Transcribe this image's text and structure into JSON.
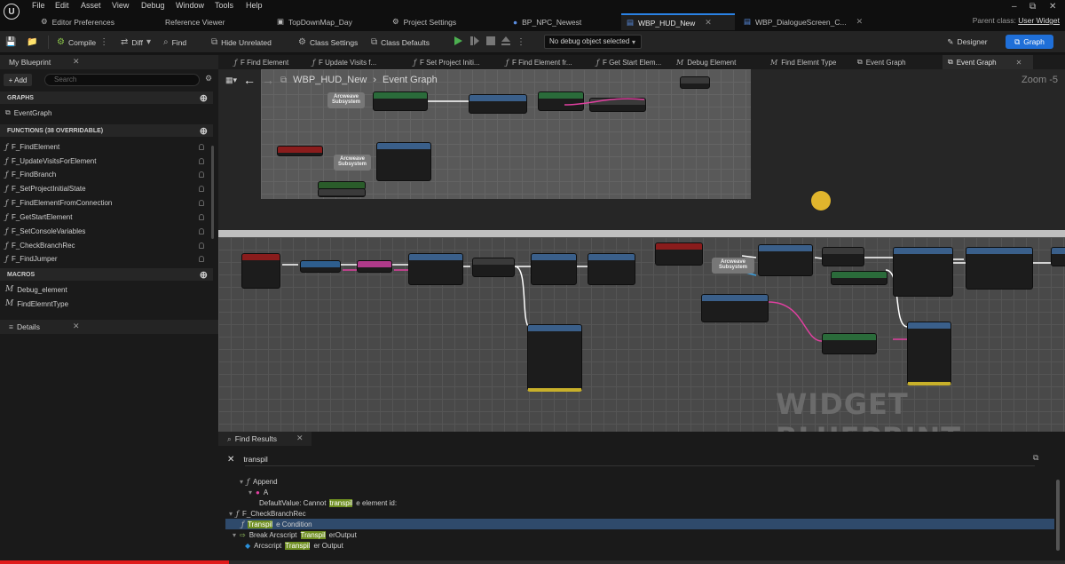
{
  "menu": [
    "File",
    "Edit",
    "Asset",
    "View",
    "Debug",
    "Window",
    "Tools",
    "Help"
  ],
  "tabs": [
    {
      "label": "Editor Preferences",
      "active": false
    },
    {
      "label": "Reference Viewer",
      "active": false
    },
    {
      "label": "TopDownMap_Day",
      "active": false
    },
    {
      "label": "Project Settings",
      "active": false
    },
    {
      "label": "BP_NPC_Newest",
      "active": false
    },
    {
      "label": "WBP_HUD_New",
      "active": true
    },
    {
      "label": "WBP_DialogueScreen_C...",
      "active": false
    }
  ],
  "parent_class": {
    "label": "Parent class:",
    "value": "User Widget"
  },
  "toolbar": {
    "compile": "Compile",
    "diff": "Diff",
    "find": "Find",
    "hide_unrelated": "Hide Unrelated",
    "class_settings": "Class Settings",
    "class_defaults": "Class Defaults",
    "debug_object": "No debug object selected",
    "designer": "Designer",
    "graph": "Graph"
  },
  "my_blueprint": {
    "title": "My Blueprint",
    "add": "+ Add",
    "search_placeholder": "Search",
    "graphs_header": "GRAPHS",
    "event_graph": "EventGraph",
    "functions_header": "FUNCTIONS (38 OVERRIDABLE)",
    "functions": [
      "F_FindElement",
      "F_UpdateVisitsForElement",
      "F_FindBranch",
      "F_SetProjectInitialState",
      "F_FindElementFromConnection",
      "F_GetStartElement",
      "F_SetConsoleVariables",
      "F_CheckBranchRec",
      "F_FindJumper"
    ],
    "macros_header": "MACROS",
    "macros": [
      "Debug_element",
      "FindElemntType"
    ]
  },
  "details": {
    "title": "Details"
  },
  "graph_tabs": [
    {
      "label": "F Find Element",
      "active": false
    },
    {
      "label": "F Update Visits f...",
      "active": false
    },
    {
      "label": "F Set Project Initi...",
      "active": false
    },
    {
      "label": "F Find Element fr...",
      "active": false
    },
    {
      "label": "F Get Start Elem...",
      "active": false
    },
    {
      "label": "Debug Element",
      "active": false
    },
    {
      "label": "Find Elemnt Type",
      "active": false
    },
    {
      "label": "Event Graph",
      "active": false
    },
    {
      "label": "Event Graph",
      "active": true
    }
  ],
  "graph": {
    "breadcrumb_bp": "WBP_HUD_New",
    "breadcrumb_graph": "Event Graph",
    "zoom": "Zoom -5",
    "watermark": "WIDGET BLUEPRINT",
    "subsystem": "Arcweave Subsystem"
  },
  "find_results": {
    "title": "Find Results",
    "query": "transpil",
    "rows": [
      {
        "indent": 14,
        "icon": "f",
        "pre": "Append",
        "hl": "",
        "post": ""
      },
      {
        "indent": 24,
        "icon": "pin",
        "pre": "A",
        "hl": "",
        "post": ""
      },
      {
        "indent": 34,
        "icon": "",
        "pre": "DefaultValue: Cannot ",
        "hl": "transpil",
        "post": "e element id:"
      },
      {
        "indent": 4,
        "icon": "f",
        "pre": "F_CheckBranchRec",
        "hl": "",
        "post": ""
      },
      {
        "indent": 14,
        "icon": "f",
        "pre": "",
        "hl": "Transpil",
        "post": "e Condition"
      },
      {
        "indent": 10,
        "icon": "node",
        "pre": "Break Arcscript",
        "hl": "Transpil",
        "post": "erOutput"
      },
      {
        "indent": 20,
        "icon": "dia",
        "pre": "Arcscript ",
        "hl": "Transpil",
        "post": "er Output"
      }
    ]
  },
  "colors": {
    "accent": "#1f6fd8",
    "highlight": "#6f8f21",
    "progress": "#e11b1b"
  }
}
